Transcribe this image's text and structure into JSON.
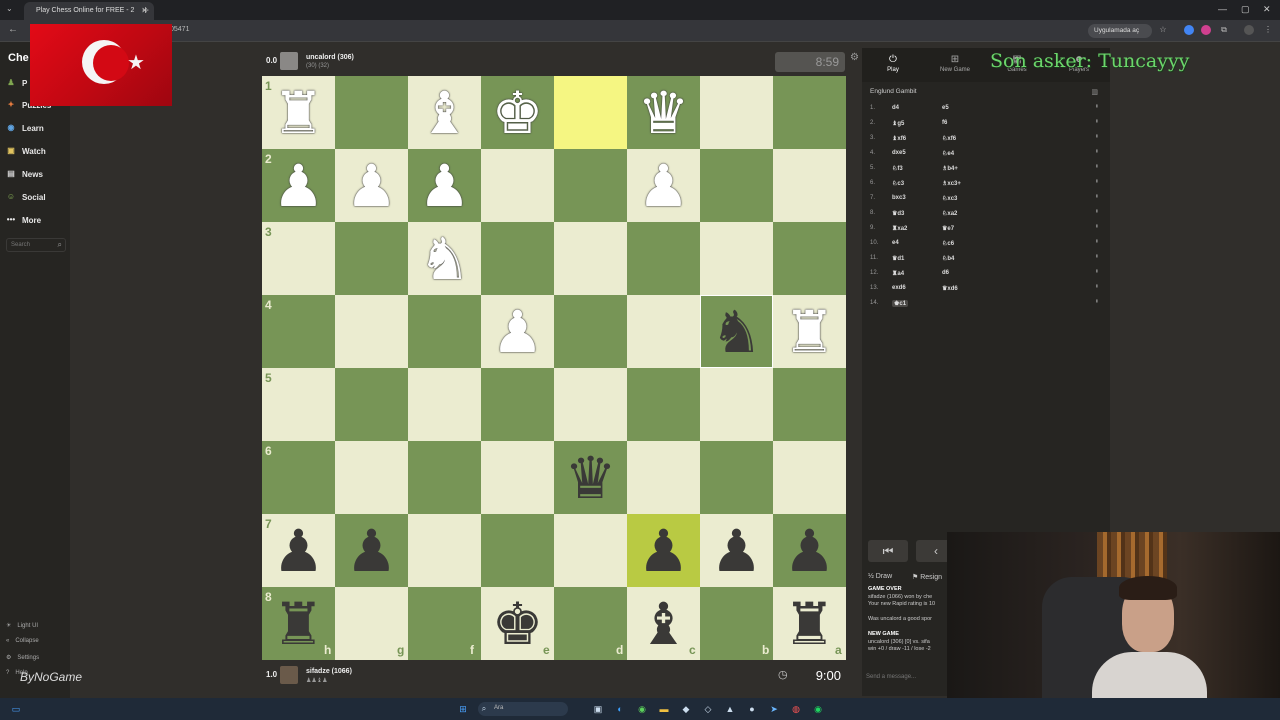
{
  "browser": {
    "tab_title": "Play Chess Online for FREE - 2",
    "url_fragment": "05471",
    "app_button": "Uygulamada aç"
  },
  "sidebar": {
    "logo": "Che",
    "items": [
      {
        "label": "P",
        "icon": "play-icon"
      },
      {
        "label": "Puzzles",
        "icon": "puzzle-icon"
      },
      {
        "label": "Learn",
        "icon": "learn-icon"
      },
      {
        "label": "Watch",
        "icon": "watch-icon"
      },
      {
        "label": "News",
        "icon": "news-icon"
      },
      {
        "label": "Social",
        "icon": "social-icon"
      },
      {
        "label": "More",
        "icon": "more-icon"
      }
    ],
    "search_placeholder": "Search",
    "footer": [
      "Light UI",
      "Collapse",
      "Settings",
      "Help"
    ],
    "watermark": "ByNoGame"
  },
  "game": {
    "top_player": {
      "score": "0.0",
      "name": "uncalord (306)",
      "sub": "(30) (32)"
    },
    "bottom_player": {
      "score": "1.0",
      "name": "sifadze (1066)",
      "sub": "♟♟♝♟"
    },
    "top_clock": "8:59",
    "bottom_clock": "9:00",
    "ranks": [
      "1",
      "2",
      "3",
      "4",
      "5",
      "6",
      "7",
      "8"
    ],
    "files": [
      "h",
      "g",
      "f",
      "e",
      "d",
      "c",
      "b",
      "a"
    ],
    "colors": {
      "light": "#ebecd0",
      "dark": "#779556",
      "hl_light": "#f5f682",
      "hl_dark": "#b9ca43"
    },
    "highlights": [
      "5-1",
      "6-7"
    ],
    "pieces": [
      {
        "c": 1,
        "r": 1,
        "glyph": "♜",
        "side": "w"
      },
      {
        "c": 3,
        "r": 1,
        "glyph": "♝",
        "side": "w"
      },
      {
        "c": 4,
        "r": 1,
        "glyph": "♚",
        "side": "w"
      },
      {
        "c": 6,
        "r": 1,
        "glyph": "♛",
        "side": "w"
      },
      {
        "c": 1,
        "r": 2,
        "glyph": "♟",
        "side": "w"
      },
      {
        "c": 2,
        "r": 2,
        "glyph": "♟",
        "side": "w"
      },
      {
        "c": 3,
        "r": 2,
        "glyph": "♟",
        "side": "w"
      },
      {
        "c": 6,
        "r": 2,
        "glyph": "♟",
        "side": "w"
      },
      {
        "c": 3,
        "r": 3,
        "glyph": "♞",
        "side": "w"
      },
      {
        "c": 4,
        "r": 4,
        "glyph": "♟",
        "side": "w"
      },
      {
        "c": 8,
        "r": 4,
        "glyph": "♜",
        "side": "w"
      },
      {
        "c": 7,
        "r": 4,
        "glyph": "♞",
        "side": "b"
      },
      {
        "c": 5,
        "r": 6,
        "glyph": "♛",
        "side": "b"
      },
      {
        "c": 1,
        "r": 7,
        "glyph": "♟",
        "side": "b"
      },
      {
        "c": 2,
        "r": 7,
        "glyph": "♟",
        "side": "b"
      },
      {
        "c": 6,
        "r": 7,
        "glyph": "♟",
        "side": "b"
      },
      {
        "c": 7,
        "r": 7,
        "glyph": "♟",
        "side": "b"
      },
      {
        "c": 8,
        "r": 7,
        "glyph": "♟",
        "side": "b"
      },
      {
        "c": 1,
        "r": 8,
        "glyph": "♜",
        "side": "b"
      },
      {
        "c": 4,
        "r": 8,
        "glyph": "♚",
        "side": "b"
      },
      {
        "c": 6,
        "r": 8,
        "glyph": "♝",
        "side": "b"
      },
      {
        "c": 8,
        "r": 8,
        "glyph": "♜",
        "side": "b"
      }
    ]
  },
  "panel": {
    "tabs": [
      {
        "label": "Play",
        "icon": "play-icon"
      },
      {
        "label": "New Game",
        "icon": "plus-icon"
      },
      {
        "label": "Games",
        "icon": "games-icon"
      },
      {
        "label": "Players",
        "icon": "players-icon"
      }
    ],
    "opening": "Englund Gambit",
    "moves": [
      {
        "n": "1.",
        "w": "d4",
        "b": "e5"
      },
      {
        "n": "2.",
        "w": "♝g5",
        "b": "f6"
      },
      {
        "n": "3.",
        "w": "♝xf6",
        "b": "♘xf6"
      },
      {
        "n": "4.",
        "w": "dxe5",
        "b": "♘e4"
      },
      {
        "n": "5.",
        "w": "♘f3",
        "b": "♗b4+"
      },
      {
        "n": "6.",
        "w": "♘c3",
        "b": "♗xc3+"
      },
      {
        "n": "7.",
        "w": "bxc3",
        "b": "♘xc3"
      },
      {
        "n": "8.",
        "w": "♛d3",
        "b": "♘xa2"
      },
      {
        "n": "9.",
        "w": "♜xa2",
        "b": "♛e7"
      },
      {
        "n": "10.",
        "w": "e4",
        "b": "♘c6"
      },
      {
        "n": "11.",
        "w": "♛d1",
        "b": "♘b4"
      },
      {
        "n": "12.",
        "w": "♜a4",
        "b": "d6"
      },
      {
        "n": "13.",
        "w": "exd6",
        "b": "♛xd6"
      },
      {
        "n": "14.",
        "w": "♚c1",
        "b": ""
      }
    ],
    "draw": "Draw",
    "resign": "Resign",
    "chat": [
      {
        "bold": "GAME OVER",
        "text": ""
      },
      {
        "bold": "",
        "text": "sifadze (1066) won by che"
      },
      {
        "bold": "",
        "text": "Your new Rapid rating is 10"
      },
      {
        "bold": "",
        "text": ""
      },
      {
        "bold": "",
        "text": "Was uncalord a good spor"
      },
      {
        "bold": "",
        "text": ""
      },
      {
        "bold": "NEW GAME",
        "text": ""
      },
      {
        "bold": "",
        "text": "uncalord (306) [0] vs. sifa"
      },
      {
        "bold": "",
        "text": "win +0 / draw -11 / lose -2"
      }
    ],
    "chat_placeholder": "Send a message...",
    "overlay": "Son asker: Tuncayyy"
  },
  "taskbar": {
    "search": "Ara"
  }
}
